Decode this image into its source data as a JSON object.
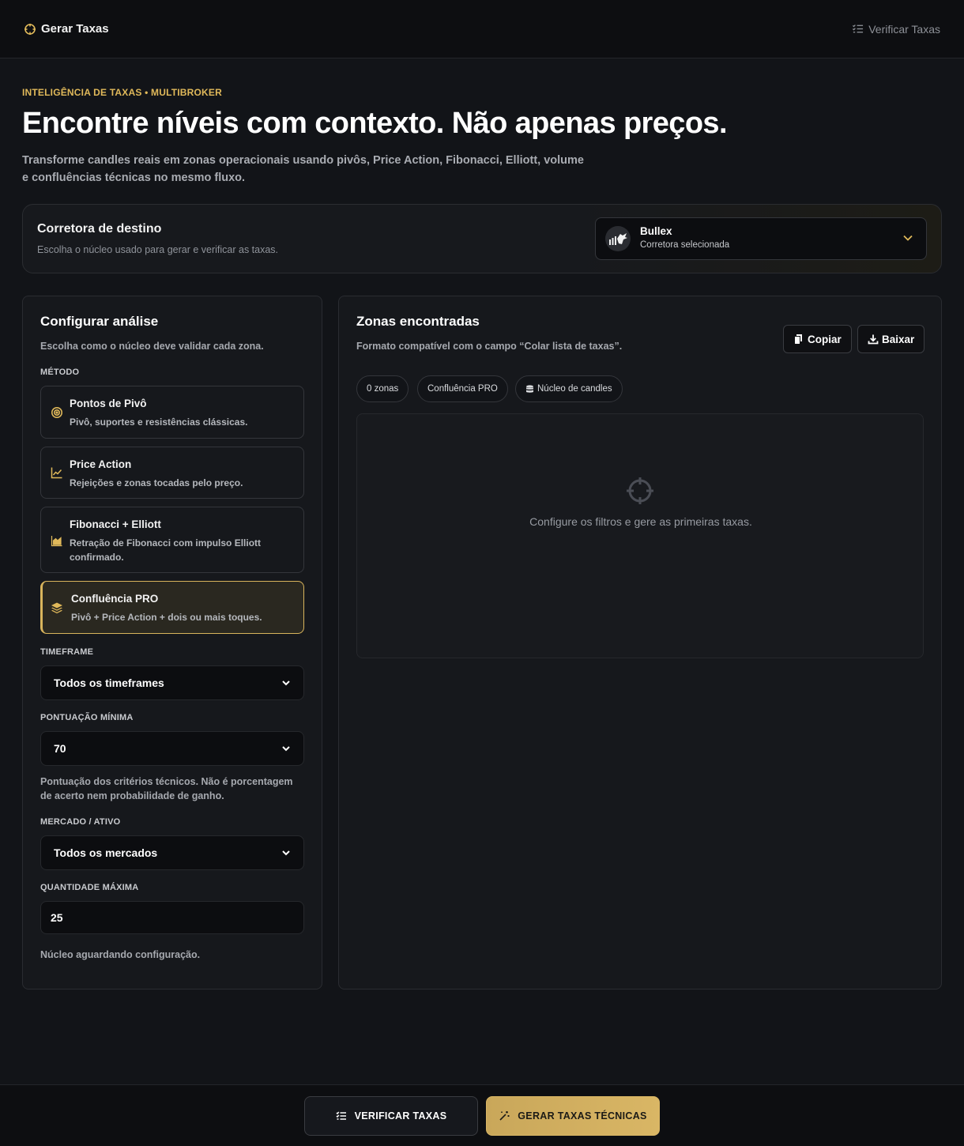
{
  "topbar": {
    "brand": "Gerar Taxas",
    "verify_link": "Verificar Taxas"
  },
  "hero": {
    "eyebrow": "INTELIGÊNCIA DE TAXAS • MULTIBROKER",
    "title": "Encontre níveis com contexto. Não apenas preços.",
    "description": "Transforme candles reais em zonas operacionais usando pivôs, Price Action, Fibonacci, Elliott, volume e confluências técnicas no mesmo fluxo."
  },
  "broker": {
    "title": "Corretora de destino",
    "description": "Escolha o núcleo usado para gerar e verificar as taxas.",
    "selected_name": "Bullex",
    "selected_sub": "Corretora selecionada"
  },
  "config": {
    "title": "Configurar análise",
    "subtitle": "Escolha como o núcleo deve validar cada zona.",
    "method_label": "MÉTODO",
    "methods": [
      {
        "title": "Pontos de Pivô",
        "desc": "Pivô, suportes e resistências clássicas.",
        "icon": "target-icon",
        "active": false
      },
      {
        "title": "Price Action",
        "desc": "Rejeições e zonas tocadas pelo preço.",
        "icon": "line-chart-icon",
        "active": false
      },
      {
        "title": "Fibonacci + Elliott",
        "desc": "Retração de Fibonacci com impulso Elliott confirmado.",
        "icon": "area-chart-icon",
        "active": false
      },
      {
        "title": "Confluência PRO",
        "desc": "Pivô + Price Action + dois ou mais toques.",
        "icon": "layers-icon",
        "active": true
      }
    ],
    "timeframe_label": "TIMEFRAME",
    "timeframe_value": "Todos os timeframes",
    "score_label": "PONTUAÇÃO MÍNIMA",
    "score_value": "70",
    "score_help": "Pontuação dos critérios técnicos. Não é porcentagem de acerto nem probabilidade de ganho.",
    "market_label": "MERCADO / ATIVO",
    "market_value": "Todos os mercados",
    "qty_label": "QUANTIDADE MÁXIMA",
    "qty_value": "25",
    "status": "Núcleo aguardando configuração."
  },
  "zones": {
    "title": "Zonas encontradas",
    "subtitle": "Formato compatível com o campo “Colar lista de taxas”.",
    "copy_label": "Copiar",
    "download_label": "Baixar",
    "chips": [
      "0 zonas",
      "Confluência PRO",
      "Núcleo de candles"
    ],
    "empty_text": "Configure os filtros e gere as primeiras taxas."
  },
  "bottom": {
    "verify_label": "VERIFICAR TAXAS",
    "generate_label": "GERAR TAXAS TÉCNICAS"
  },
  "colors": {
    "accent": "#d8b45c",
    "background": "#121418",
    "panel": "#16181c"
  }
}
